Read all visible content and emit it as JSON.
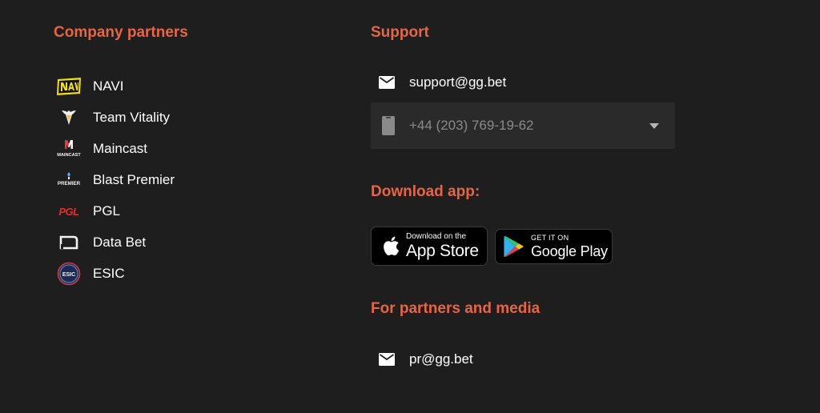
{
  "partners": {
    "title": "Company partners",
    "items": [
      {
        "name": "NAVI",
        "icon": "navi-logo-icon"
      },
      {
        "name": "Team Vitality",
        "icon": "vitality-logo-icon"
      },
      {
        "name": "Maincast",
        "icon": "maincast-logo-icon",
        "logo_text": "MAINCAST"
      },
      {
        "name": "Blast Premier",
        "icon": "blast-premier-logo-icon",
        "logo_text": "PREMIER"
      },
      {
        "name": "PGL",
        "icon": "pgl-logo-icon",
        "logo_text": "PGL"
      },
      {
        "name": "Data Bet",
        "icon": "databet-logo-icon"
      },
      {
        "name": "ESIC",
        "icon": "esic-logo-icon",
        "logo_text": "ESIC"
      }
    ]
  },
  "support": {
    "title": "Support",
    "email": "support@gg.bet",
    "phone": "+44 (203) 769-19-62"
  },
  "download": {
    "title": "Download app:",
    "appstore": {
      "small": "Download on the",
      "big": "App Store"
    },
    "googleplay": {
      "small": "GET IT ON",
      "big": "Google Play"
    }
  },
  "media": {
    "title": "For partners and media",
    "email": "pr@gg.bet"
  },
  "colors": {
    "background": "#1e1e1e",
    "accent": "#e8653f",
    "text": "#ffffff",
    "muted": "#8a8a8a",
    "input_bg": "#2a2a2a"
  }
}
